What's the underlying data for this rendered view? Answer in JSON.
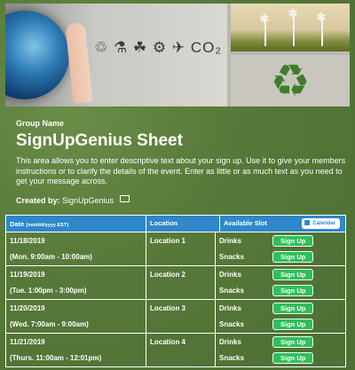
{
  "header": {
    "group_label": "Group Name",
    "title": "SignUpGenius Sheet",
    "description": "This area allows you to enter descriptive text about your sign up. Use it to give your members instructions or to clarify the details of the event. Enter as little or as much text as you need to get your message across.",
    "created_by_label": "Created by:",
    "created_by_name": "SignUpGenius"
  },
  "table": {
    "col_date": "Date",
    "col_date_format": "(mm/dd/yyyy EST)",
    "col_location": "Location",
    "col_slot": "Available Slot",
    "calendar_label": "Calendar",
    "rows": [
      {
        "date": "11/18/2019",
        "time": "(Mon. 9:00am - 10:00am)",
        "location": "Location 1",
        "slots": [
          {
            "name": "Drinks",
            "button": "Sign Up"
          },
          {
            "name": "Snacks",
            "button": "Sign Up"
          }
        ]
      },
      {
        "date": "11/19/2019",
        "time": "(Tue. 1:00pm - 3:00pm)",
        "location": "Location 2",
        "slots": [
          {
            "name": "Drinks",
            "button": "Sign Up"
          },
          {
            "name": "Snacks",
            "button": "Sign Up"
          }
        ]
      },
      {
        "date": "11/20/2019",
        "time": "(Wed. 7:00am - 9:00am)",
        "location": "Location 3",
        "slots": [
          {
            "name": "Drinks",
            "button": "Sign Up"
          },
          {
            "name": "Snacks",
            "button": "Sign Up"
          }
        ]
      },
      {
        "date": "11/21/2019",
        "time": "(Thurs. 11:00am - 12:01pm)",
        "location": "Location 4",
        "slots": [
          {
            "name": "Drinks",
            "button": "Sign Up"
          },
          {
            "name": "Snacks",
            "button": "Sign Up"
          }
        ]
      }
    ]
  },
  "banner": {
    "doodles_text": "♲ ⚗ ☘ ⚙ ✈ CO₂"
  }
}
